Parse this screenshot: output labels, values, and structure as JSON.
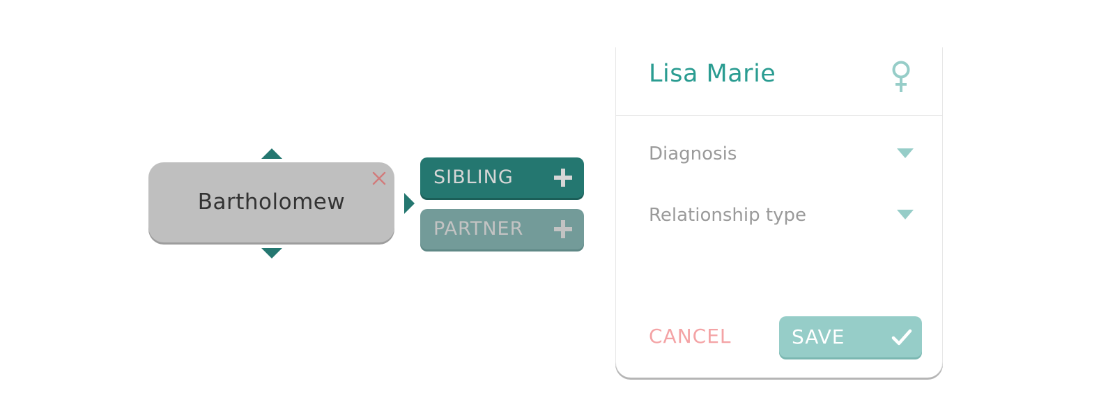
{
  "node": {
    "name": "Bartholomew"
  },
  "add_buttons": {
    "sibling_label": "SIBLING",
    "partner_label": "PARTNER"
  },
  "panel": {
    "title": "Lisa Marie",
    "gender_icon": "female-symbol-icon",
    "fields": {
      "diagnosis_label": "Diagnosis",
      "relationship_label": "Relationship type"
    },
    "actions": {
      "cancel_label": "CANCEL",
      "save_label": "SAVE"
    }
  },
  "icons": {
    "remove": "close-icon",
    "add": "plus-icon",
    "save": "checkmark-icon",
    "dropdown": "caret-down-icon",
    "expand_up": "triangle-up-icon",
    "expand_down": "triangle-down-icon",
    "expand_right": "triangle-right-icon"
  },
  "colors": {
    "primary_teal": "#247770",
    "muted_teal": "#739b99",
    "light_teal": "#96cdc8",
    "title_teal": "#2a9c91",
    "node_gray": "#bfbfbf",
    "remove_red": "#d27b7b",
    "cancel_pink": "#f4a3a5"
  }
}
